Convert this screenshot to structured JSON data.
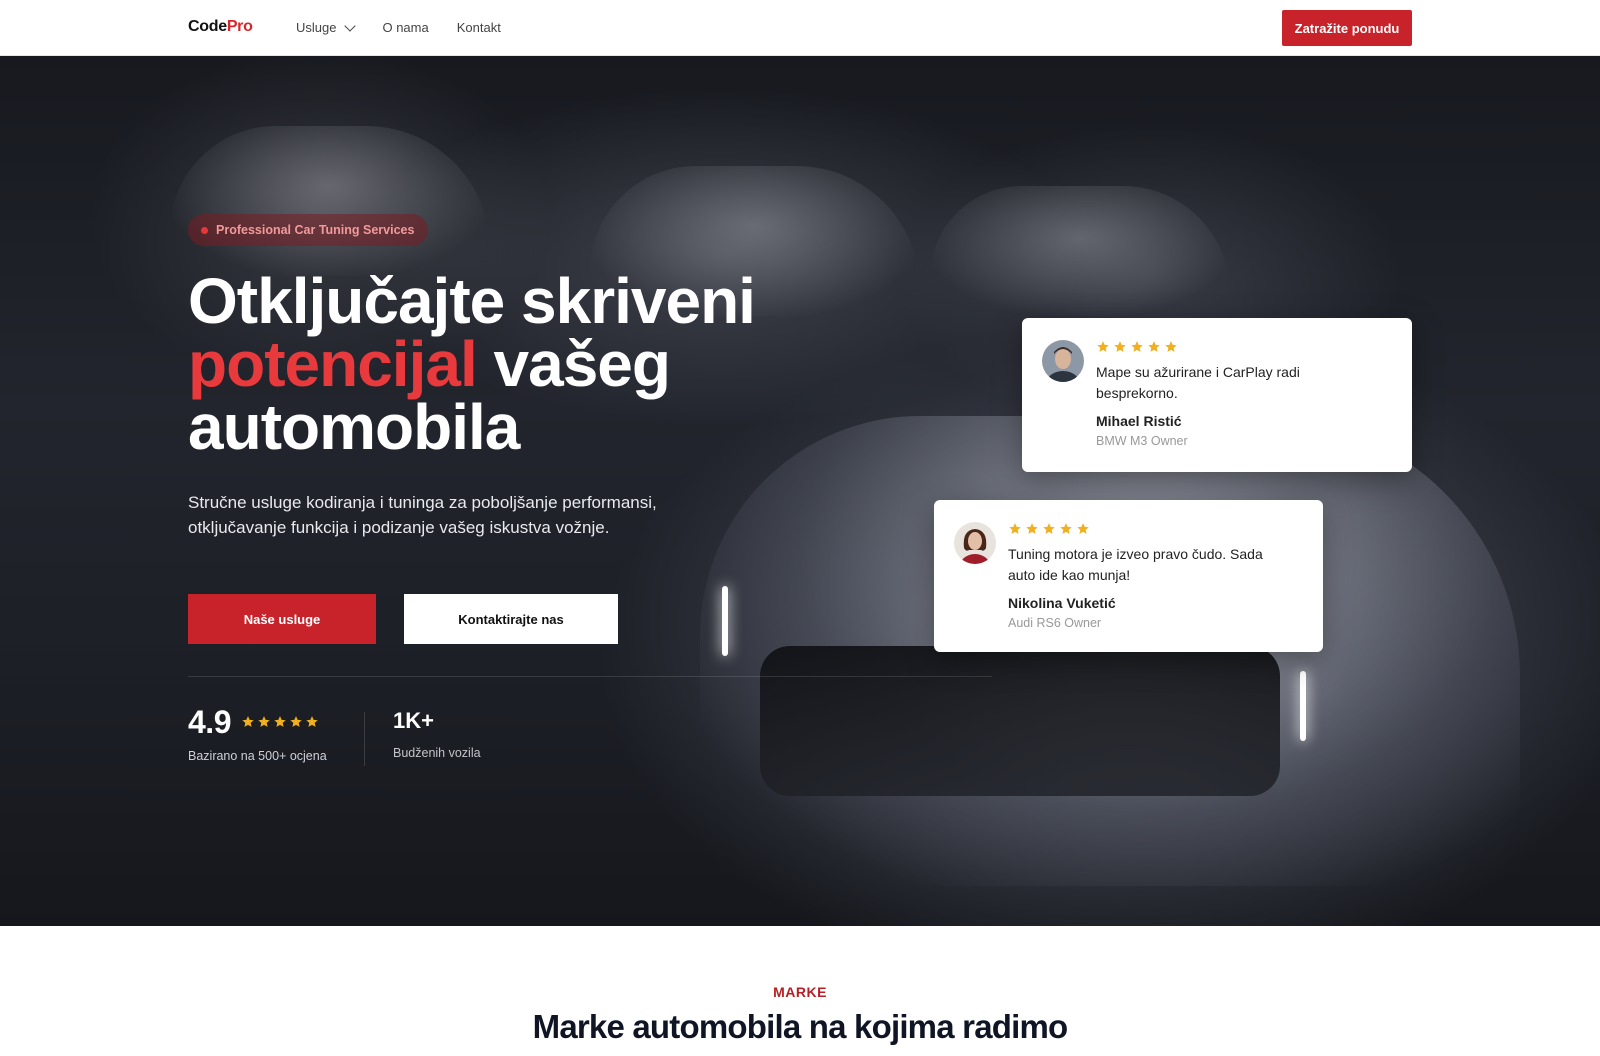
{
  "nav": {
    "logo_code": "Code",
    "logo_pro": "Pro",
    "menu": [
      {
        "label": "Usluge",
        "has_dropdown": true
      },
      {
        "label": "O nama",
        "has_dropdown": false
      },
      {
        "label": "Kontakt",
        "has_dropdown": false
      }
    ],
    "cta_label": "Zatražite ponudu"
  },
  "hero": {
    "badge": "Professional Car Tuning Services",
    "title_line1": "Otključajte skriveni",
    "title_accent": "potencijal",
    "title_line2_rest": " vašeg",
    "title_line3": "automobila",
    "subtitle": "Stručne usluge kodiranja i tuninga za poboljšanje performansi, otključavanje funkcija i podizanje vašeg iskustva vožnje.",
    "primary_button": "Naše usluge",
    "secondary_button": "Kontaktirajte nas",
    "rating": {
      "value": "4.9",
      "stars": 5,
      "label": "Bazirano na 500+ ocjena"
    },
    "count": {
      "value": "1K+",
      "label": "Budženih vozila"
    }
  },
  "reviews": [
    {
      "stars": 5,
      "text": "Mape su ažurirane i CarPlay radi besprekorno.",
      "name": "Mihael Ristić",
      "role": "BMW M3 Owner",
      "avatar": "man-avatar"
    },
    {
      "stars": 5,
      "text": "Tuning motora je izveo pravo čudo. Sada auto ide kao munja!",
      "name": "Nikolina Vuketić",
      "role": "Audi RS6 Owner",
      "avatar": "woman-avatar"
    }
  ],
  "brands_section": {
    "tag": "MARKE",
    "title": "Marke automobila na kojima radimo"
  },
  "colors": {
    "accent": "#c8232a",
    "accent_text": "#e8393c",
    "star": "#f2b01e",
    "hero_bg": "#1c1e25"
  }
}
